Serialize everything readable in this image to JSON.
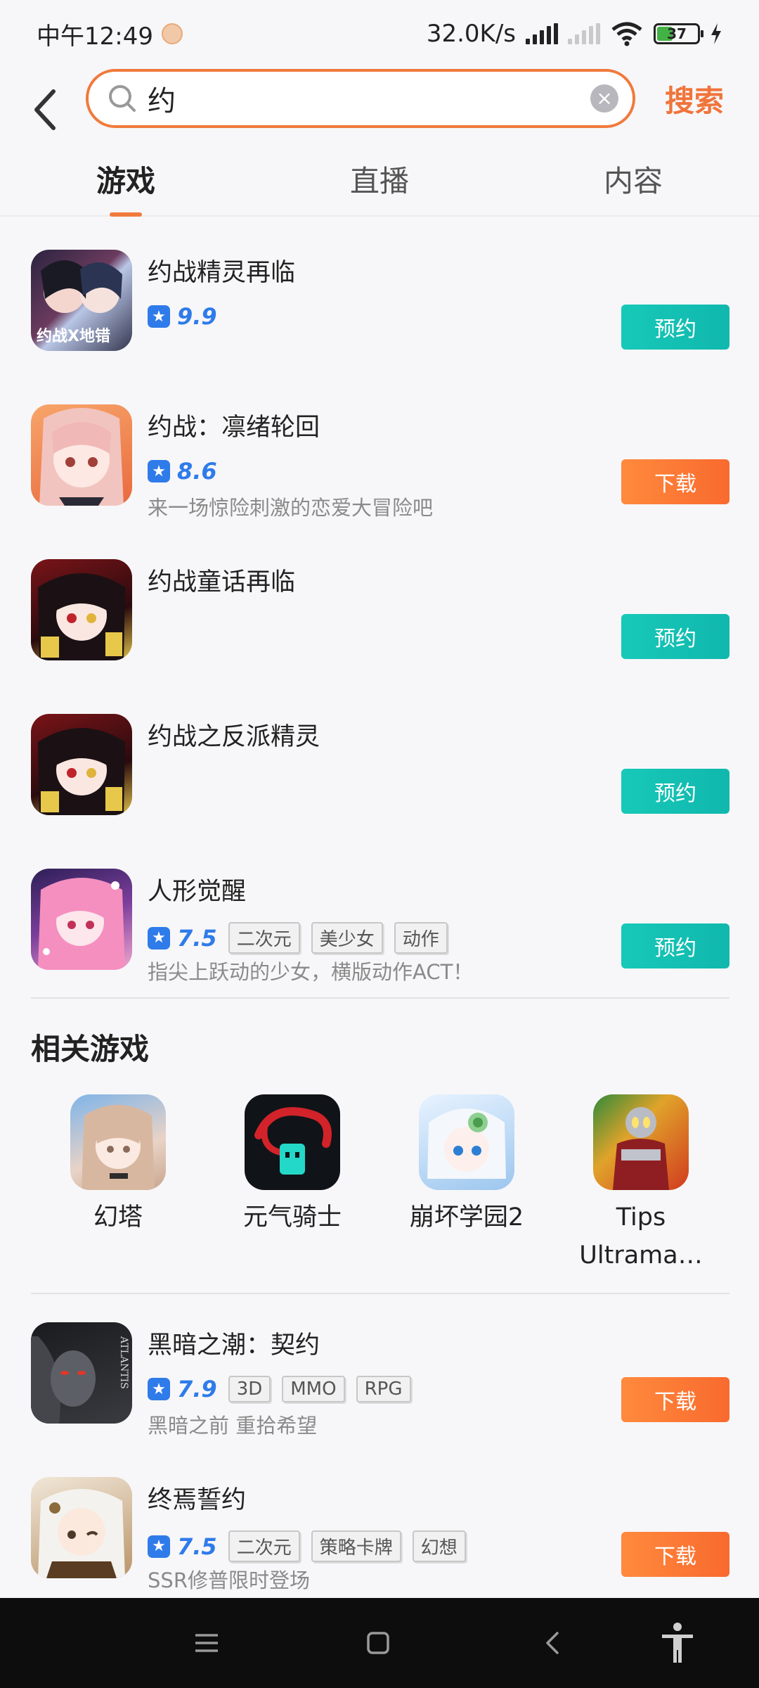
{
  "status_bar": {
    "time": "中午12:49",
    "net_speed": "32.0K/s",
    "battery": "37"
  },
  "search": {
    "query": "约",
    "submit_label": "搜索"
  },
  "tabs": [
    {
      "label": "游戏",
      "active": true
    },
    {
      "label": "直播",
      "active": false
    },
    {
      "label": "内容",
      "active": false
    }
  ],
  "results": [
    {
      "title": "约战精灵再临",
      "score": "9.9",
      "tags": [],
      "desc": "",
      "action": "预约",
      "action_color": "#17c9b8",
      "icon": "date-a-live-spirit-icon"
    },
    {
      "title": "约战：凛绪轮回",
      "score": "8.6",
      "tags": [],
      "desc": "来一场惊险刺激的恋爱大冒险吧",
      "action": "下载",
      "action_color": "#f96a2e",
      "icon": "rinne-utopia-icon"
    },
    {
      "title": "约战童话再临",
      "score": "",
      "tags": [],
      "desc": "",
      "action": "预约",
      "action_color": "#17c9b8",
      "icon": "kurumi-fairy-tale-icon"
    },
    {
      "title": "约战之反派精灵",
      "score": "",
      "tags": [],
      "desc": "",
      "action": "预约",
      "action_color": "#17c9b8",
      "icon": "kurumi-villain-icon"
    },
    {
      "title": "人形觉醒",
      "score": "7.5",
      "tags": [
        "二次元",
        "美少女",
        "动作"
      ],
      "desc": "指尖上跃动的少女，横版动作ACT！",
      "action": "预约",
      "action_color": "#17c9b8",
      "icon": "pink-hair-girl-icon"
    }
  ],
  "related_section": {
    "title": "相关游戏",
    "items": [
      {
        "name": "幻塔",
        "icon": "tower-of-fantasy-icon"
      },
      {
        "name": "元气骑士",
        "icon": "soul-knight-icon"
      },
      {
        "name": "崩坏学园2",
        "icon": "honkai-gakuen-2-icon"
      },
      {
        "name": "Tips\nUltrama…",
        "line1": "Tips",
        "line2": "Ultrama…",
        "icon": "ultraman-icon"
      }
    ]
  },
  "more_results": [
    {
      "title": "黑暗之潮：契约",
      "score": "7.9",
      "tags": [
        "3D",
        "MMO",
        "RPG"
      ],
      "desc": "黑暗之前 重拾希望",
      "action": "下载",
      "icon": "atlantis-dark-tide-icon"
    },
    {
      "title": "终焉誓约",
      "score": "7.5",
      "tags": [
        "二次元",
        "策略卡牌",
        "幻想"
      ],
      "desc": "SSR修普限时登场",
      "action": "下载",
      "icon": "white-hair-girl-icon"
    }
  ],
  "colors": {
    "accent": "#f07a3c",
    "teal": "#17c9b8",
    "orange": "#f96a2e",
    "rating_blue": "#2f7bea"
  }
}
